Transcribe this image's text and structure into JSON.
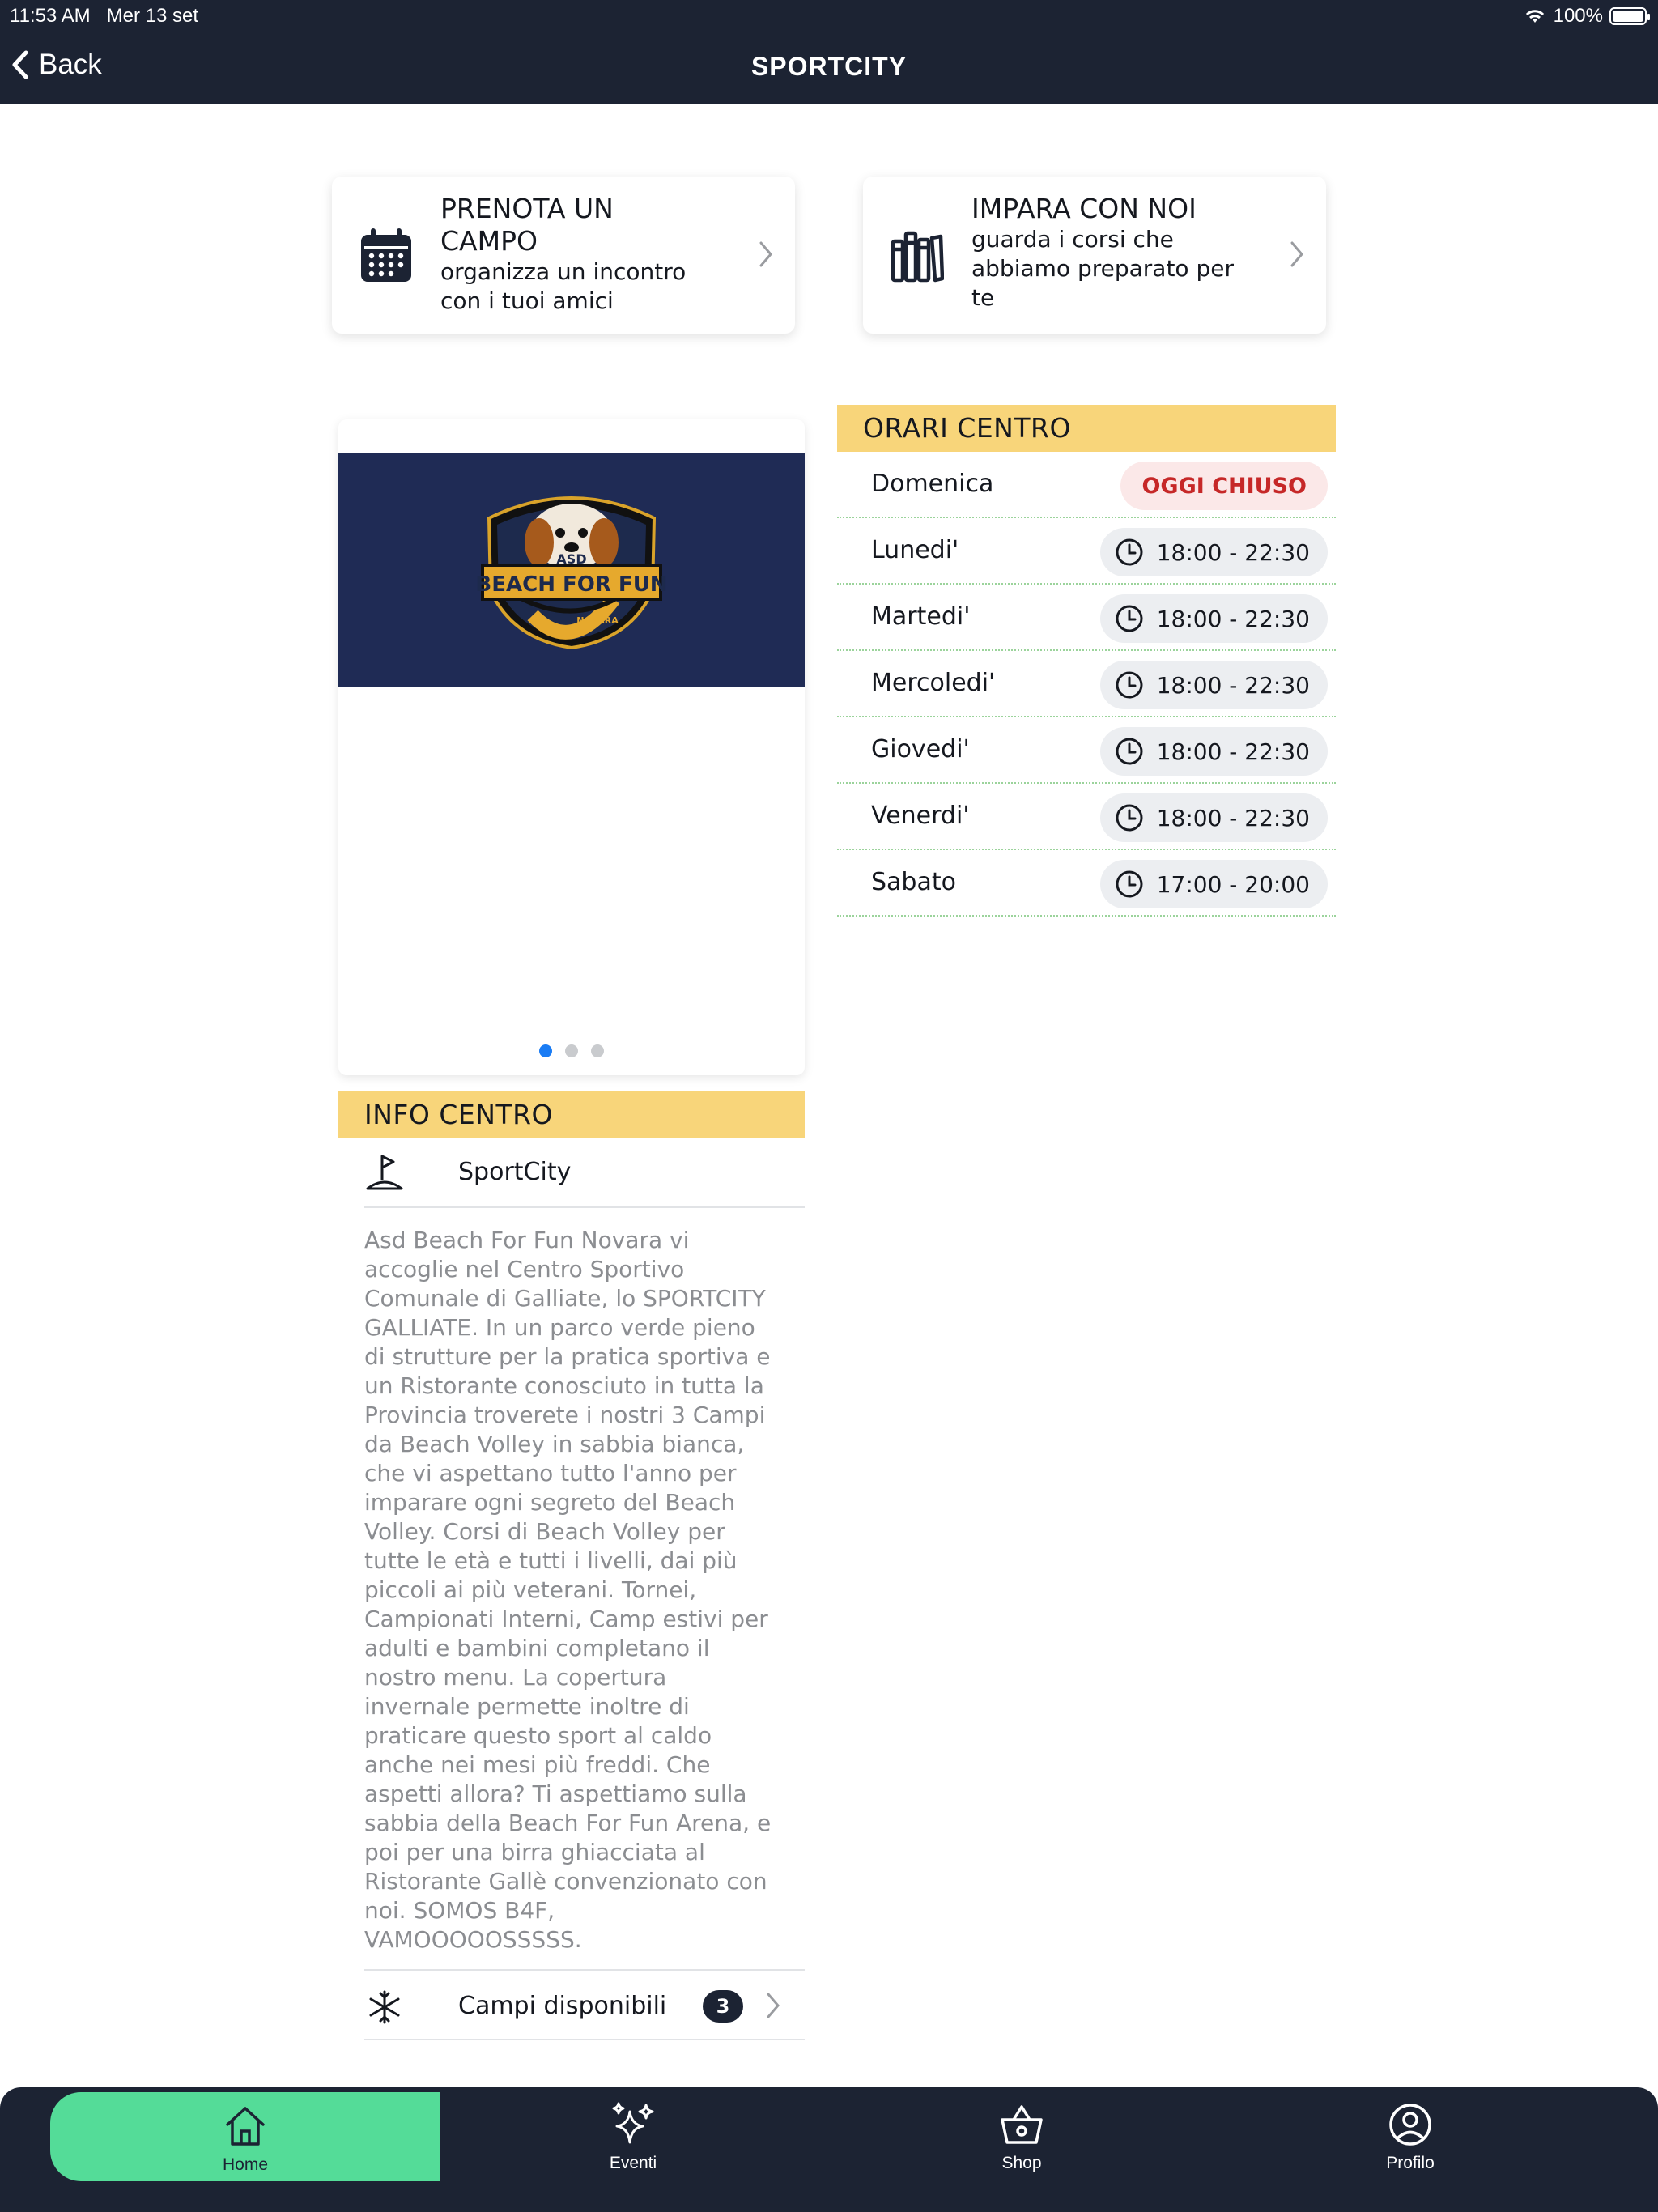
{
  "status_bar": {
    "time": "11:53 AM",
    "date": "Mer 13 set",
    "battery": "100%"
  },
  "nav": {
    "back_label": "Back",
    "title": "SPORTCITY"
  },
  "actions": [
    {
      "title": "PRENOTA UN CAMPO",
      "subtitle": "organizza un incontro con i tuoi amici",
      "icon": "calendar-icon"
    },
    {
      "title": "IMPARA CON NOI",
      "subtitle": "guarda i corsi che abbiamo preparato per te",
      "icon": "books-icon"
    }
  ],
  "carousel": {
    "logo_text": "BEACH FOR FUN",
    "logo_top": "ASD",
    "logo_bottom": "NOVARA",
    "pages": 3,
    "active_page": 1
  },
  "orari": {
    "heading": "ORARI CENTRO",
    "days": [
      {
        "day": "Domenica",
        "hours": "OGGI CHIUSO",
        "closed": true
      },
      {
        "day": "Lunedi'",
        "hours": "18:00 - 22:30"
      },
      {
        "day": "Martedi'",
        "hours": "18:00 - 22:30"
      },
      {
        "day": "Mercoledi'",
        "hours": "18:00 - 22:30"
      },
      {
        "day": "Giovedi'",
        "hours": "18:00 - 22:30"
      },
      {
        "day": "Venerdi'",
        "hours": "18:00 - 22:30"
      },
      {
        "day": "Sabato",
        "hours": "17:00 - 20:00"
      }
    ]
  },
  "info": {
    "heading": "INFO CENTRO",
    "name": "SportCity",
    "description": "Asd Beach For Fun Novara vi accoglie nel Centro Sportivo Comunale di Galliate, lo SPORTCITY GALLIATE. In un parco verde pieno di strutture per la pratica sportiva e un Ristorante conosciuto in tutta la Provincia troverete i nostri 3 Campi da Beach Volley in sabbia bianca, che vi aspettano tutto l'anno per imparare ogni segreto del Beach Volley. Corsi di Beach Volley per tutte le età e tutti i livelli, dai più piccoli ai più veterani. Tornei, Campionati Interni, Camp estivi per adulti e bambini completano il nostro menu. La copertura invernale permette inoltre di praticare questo sport al caldo anche nei mesi più freddi. Che aspetti allora? Ti aspettiamo sulla sabbia della Beach For Fun Arena, e poi per una birra ghiacciata al Ristorante Gallè convenzionato con noi. SOMOS B4F, VAMOOOOOSSSSS.",
    "campi_label": "Campi disponibili",
    "campi_count": "3"
  },
  "tabs": [
    {
      "label": "Home",
      "icon": "home-icon",
      "active": true
    },
    {
      "label": "Eventi",
      "icon": "sparkles-icon"
    },
    {
      "label": "Shop",
      "icon": "basket-icon"
    },
    {
      "label": "Profilo",
      "icon": "profile-icon"
    }
  ],
  "colors": {
    "navy": "#1c2333",
    "yellow": "#f8d57a",
    "green": "#54dc98",
    "closed_red": "#c62828",
    "banner": "#1f2b55"
  }
}
